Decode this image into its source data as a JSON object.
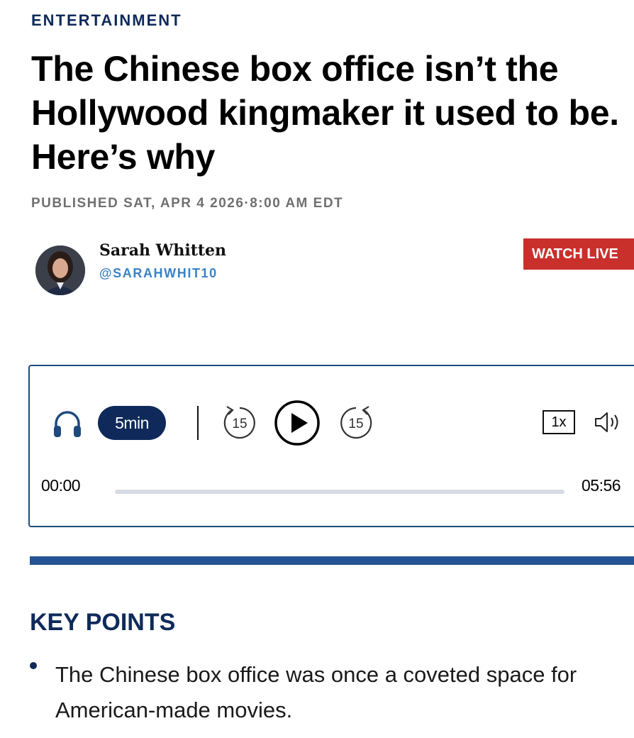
{
  "article": {
    "category": "ENTERTAINMENT",
    "headline": "The Chinese box office isn’t the Hollywood kingmaker it used to be. Here’s why",
    "published": "PUBLISHED SAT, APR 4 2026·8:00 AM EDT"
  },
  "author": {
    "name": "Sarah Whitten",
    "handle": "@SARAHWHIT10"
  },
  "header": {
    "watch_live_label": "WATCH LIVE"
  },
  "audio_player": {
    "duration_label": "5min",
    "rewind_seconds": "15",
    "forward_seconds": "15",
    "speed_label": "1x",
    "current_time": "00:00",
    "total_time": "05:56",
    "progress": 0,
    "icons": [
      "headphones-icon",
      "rewind-15-icon",
      "play-icon",
      "forward-15-icon",
      "volume-icon"
    ]
  },
  "key_points": {
    "heading": "KEY POINTS",
    "items": [
      "The Chinese box office was once a coveted space for American-made movies."
    ]
  },
  "colors": {
    "brand_navy": "#0f2a5a",
    "live_red": "#c9302c",
    "handle_blue": "#3b82c4",
    "rule_blue": "#245493"
  }
}
